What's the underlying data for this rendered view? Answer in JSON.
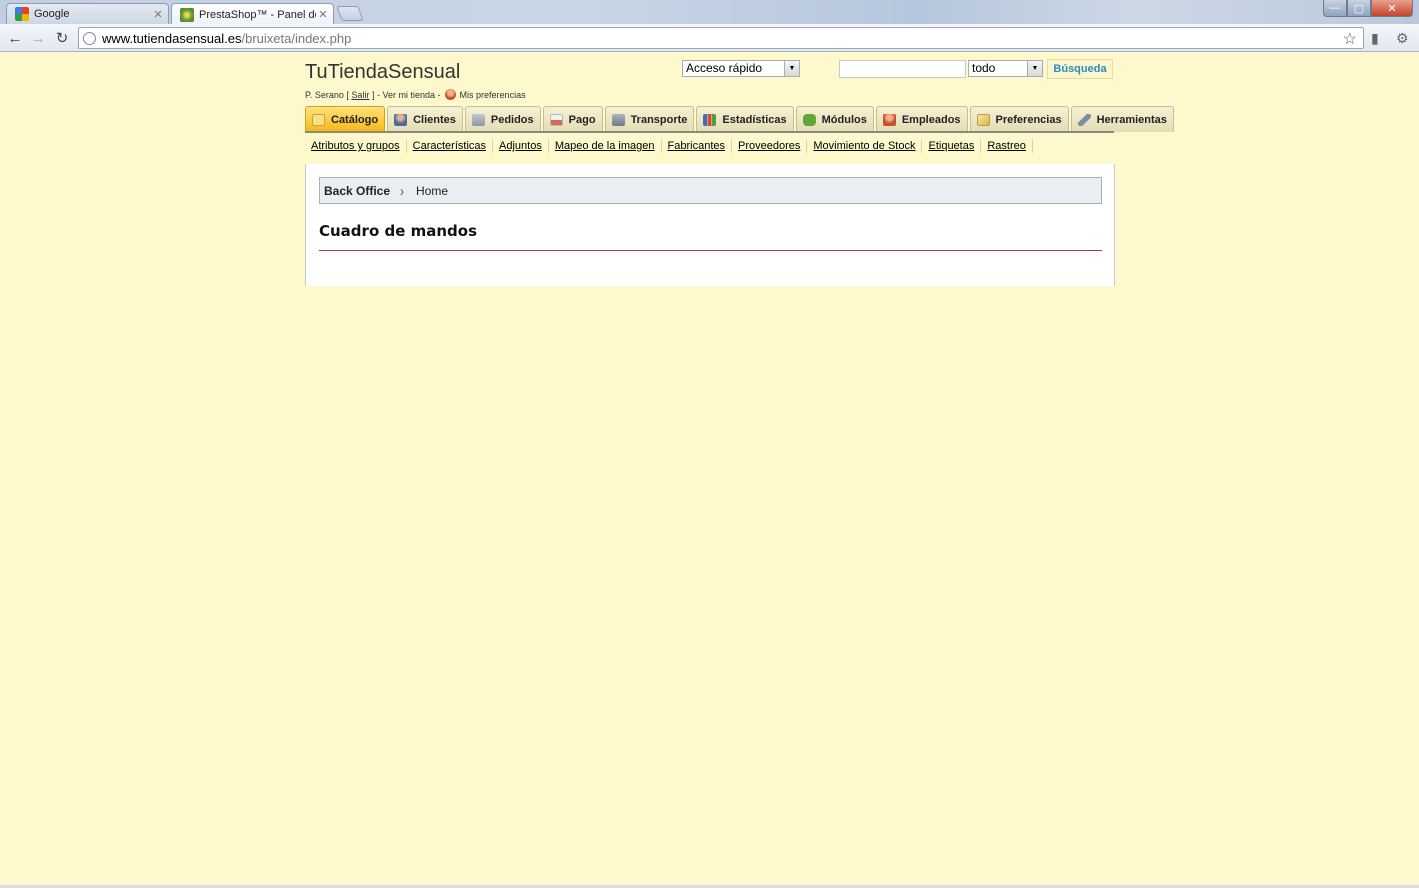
{
  "browser": {
    "tabs": [
      {
        "title": "Google",
        "active": false,
        "favicon_color": "#3b7de0"
      },
      {
        "title": "PrestaShop™ - Panel de adr",
        "active": true,
        "favicon_color": "#6ba43a"
      }
    ],
    "url_host": "www.tutiendasensual.es",
    "url_path": "/bruixeta/index.php",
    "window_controls": {
      "minimize": "—",
      "maximize": "▢",
      "close": "✕"
    }
  },
  "header": {
    "shop_name": "TuTiendaSensual",
    "user_name": "P. Serano",
    "bracket_open": "[",
    "logout_label": "Salir",
    "bracket_close": "]",
    "separator": "-",
    "view_store_label": "Ver mi tienda",
    "preferences_label": "Mis preferencias",
    "quick_access_label": "Acceso rápido",
    "search_value": "",
    "search_scope": "todo",
    "search_button": "Búsqueda"
  },
  "tabs": [
    {
      "label": "Catálogo",
      "active": true,
      "icon": "catalog-icon",
      "color": "#e3a326"
    },
    {
      "label": "Clientes",
      "active": false,
      "icon": "customers-icon",
      "color": "#4a6b9a"
    },
    {
      "label": "Pedidos",
      "active": false,
      "icon": "orders-icon",
      "color": "#9aa4b0"
    },
    {
      "label": "Pago",
      "active": false,
      "icon": "payment-icon",
      "color": "#d6695a"
    },
    {
      "label": "Transporte",
      "active": false,
      "icon": "shipping-icon",
      "color": "#7b8796"
    },
    {
      "label": "Estadísticas",
      "active": false,
      "icon": "stats-icon",
      "color": "#3a6fc4"
    },
    {
      "label": "Módulos",
      "active": false,
      "icon": "modules-icon",
      "color": "#5ea83a"
    },
    {
      "label": "Empleados",
      "active": false,
      "icon": "employees-icon",
      "color": "#c9502f"
    },
    {
      "label": "Preferencias",
      "active": false,
      "icon": "preferences-icon",
      "color": "#d8b54a"
    },
    {
      "label": "Herramientas",
      "active": false,
      "icon": "tools-icon",
      "color": "#7c8ea6"
    }
  ],
  "subnav": [
    "Atributos y grupos",
    "Características",
    "Adjuntos",
    "Mapeo de la imagen",
    "Fabricantes",
    "Proveedores",
    "Movimiento de Stock",
    "Etiquetas",
    "Rastreo"
  ],
  "breadcrumb": {
    "root": "Back Office",
    "separator": "›",
    "leaf": "Home"
  },
  "main": {
    "heading": "Cuadro de mandos"
  }
}
